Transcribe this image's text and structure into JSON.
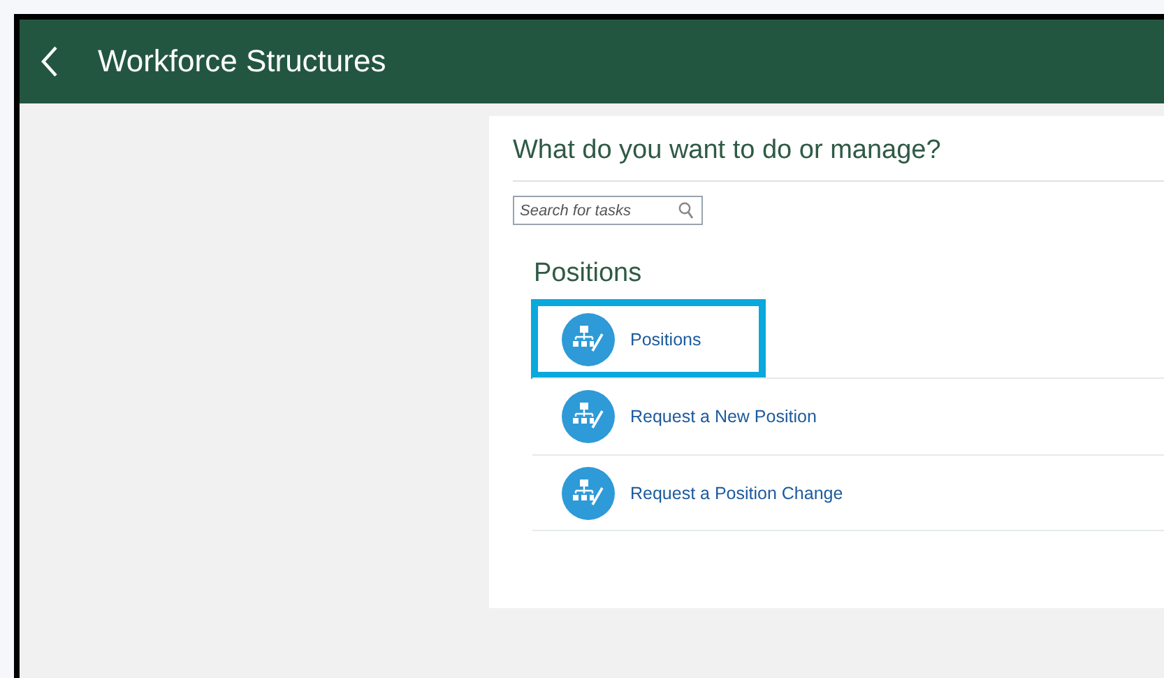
{
  "header": {
    "title": "Workforce Structures"
  },
  "panel": {
    "heading": "What do you want to do or manage?",
    "search": {
      "placeholder": "Search for tasks"
    },
    "section": "Positions",
    "tasks": [
      {
        "label": "Positions",
        "selected": true
      },
      {
        "label": "Request a New Position",
        "selected": false
      },
      {
        "label": "Request a Position Change",
        "selected": false
      }
    ]
  }
}
